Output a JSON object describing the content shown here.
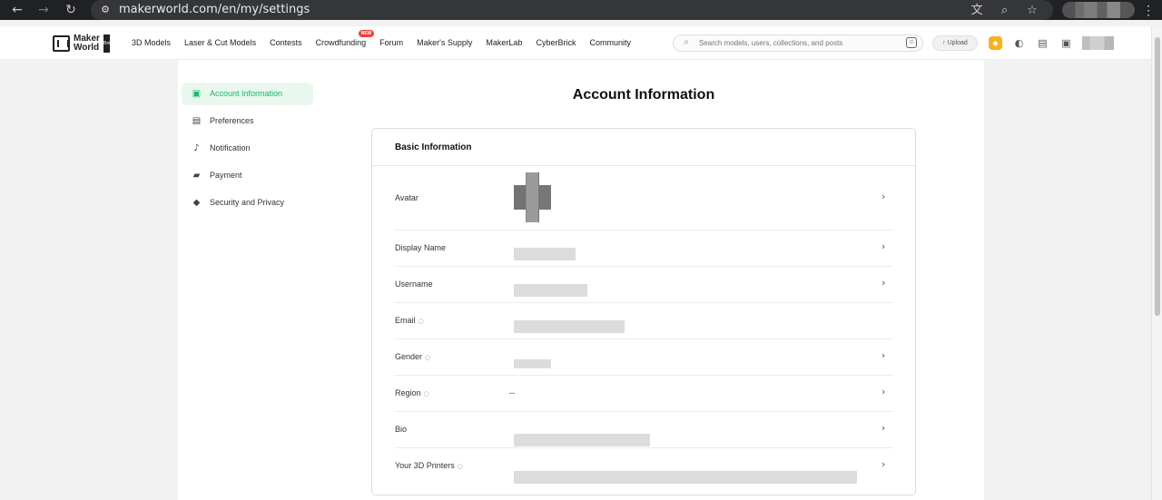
{
  "browser": {
    "url": "makerworld.com/en/my/settings",
    "back_icon": "arrow-left-icon",
    "forward_icon": "arrow-right-icon",
    "reload_icon": "reload-icon",
    "site_icon": "site-settings-icon",
    "tools": [
      "translate-icon",
      "zoom-icon",
      "star-icon"
    ],
    "menu_icon": "more-vertical-icon"
  },
  "site": {
    "logo_line1": "Maker",
    "logo_line2": "World",
    "logo_beta": "Beta",
    "nav": [
      {
        "label": "3D Models"
      },
      {
        "label": "Laser & Cut Models"
      },
      {
        "label": "Contests"
      },
      {
        "label": "Crowdfunding",
        "badge": "NEW"
      },
      {
        "label": "Forum"
      },
      {
        "label": "Maker's Supply"
      },
      {
        "label": "MakerLab"
      },
      {
        "label": "CyberBrick"
      },
      {
        "label": "Community"
      }
    ],
    "search_placeholder": "Search models, users, collections, and posts",
    "upload_label": "Upload"
  },
  "sidebar": {
    "items": [
      {
        "label": "Account Information",
        "icon": "account-icon",
        "active": true
      },
      {
        "label": "Preferences",
        "icon": "preferences-icon",
        "active": false
      },
      {
        "label": "Notification",
        "icon": "bell-icon",
        "active": false
      },
      {
        "label": "Payment",
        "icon": "wallet-icon",
        "active": false
      },
      {
        "label": "Security and Privacy",
        "icon": "shield-icon",
        "active": false
      }
    ]
  },
  "main": {
    "title": "Account Information",
    "section_title": "Basic Information",
    "rows": [
      {
        "label": "Avatar",
        "value": "",
        "private": false,
        "editable": true
      },
      {
        "label": "Display Name",
        "value": "",
        "private": false,
        "editable": true
      },
      {
        "label": "Username",
        "value": "",
        "private": false,
        "editable": true
      },
      {
        "label": "Email",
        "value": "",
        "private": true,
        "editable": false
      },
      {
        "label": "Gender",
        "value": "",
        "private": true,
        "editable": true
      },
      {
        "label": "Region",
        "value": "--",
        "private": true,
        "editable": true
      },
      {
        "label": "Bio",
        "value": "",
        "private": false,
        "editable": true
      },
      {
        "label": "Your 3D Printers",
        "value": "",
        "private": true,
        "editable": true
      }
    ]
  },
  "colors": {
    "accent": "#17b86a",
    "active_background": "#eaf7ee",
    "browser_bar": "#202124"
  }
}
